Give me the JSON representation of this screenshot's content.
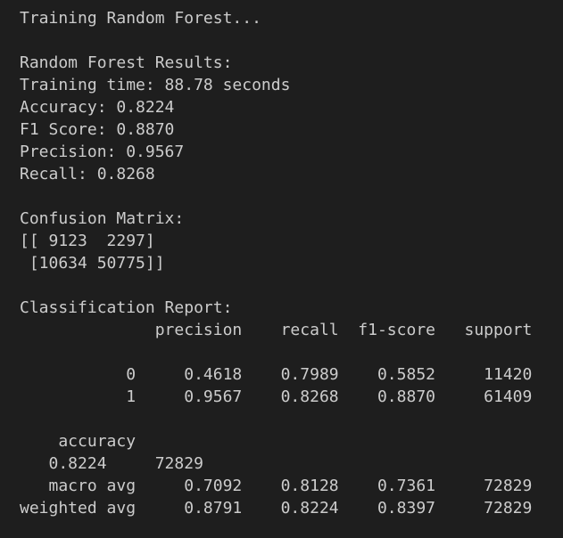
{
  "terminal": {
    "lines": [
      "Training Random Forest...",
      "",
      "Random Forest Results:",
      "Training time: 88.78 seconds",
      "Accuracy: 0.8224",
      "F1 Score: 0.8870",
      "Precision: 0.9567",
      "Recall: 0.8268",
      "",
      "Confusion Matrix:",
      "[[ 9123  2297]",
      " [10634 50775]]",
      "",
      "Classification Report:",
      "              precision    recall  f1-score   support",
      "",
      "           0     0.4618    0.7989    0.5852     11420",
      "           1     0.9567    0.8268    0.8870     61409",
      "",
      "    accuracy",
      "   0.8224     72829",
      "   macro avg     0.7092    0.8128    0.7361     72829",
      "weighted avg     0.8791    0.8224    0.8397     72829"
    ]
  }
}
